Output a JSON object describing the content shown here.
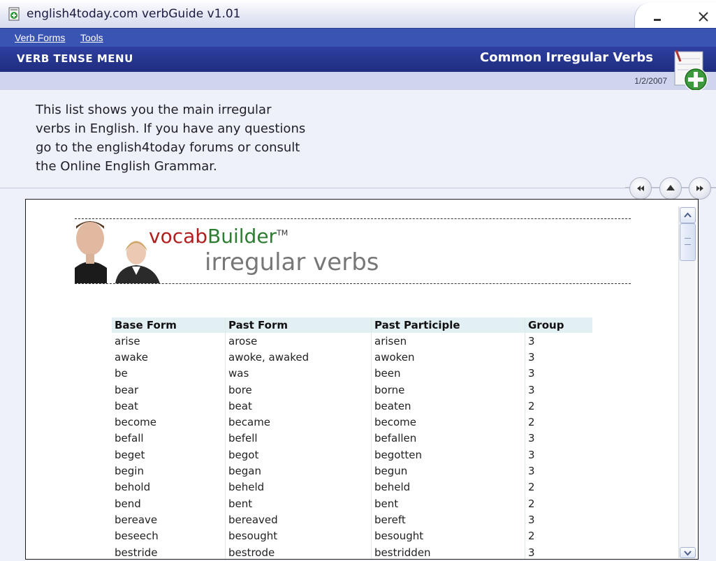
{
  "window": {
    "title": "english4today.com verbGuide v1.01",
    "minimize_icon": "minimize-icon",
    "close_icon": "close-icon"
  },
  "menubar": {
    "items": [
      {
        "label": "Verb Forms",
        "accel": "V"
      },
      {
        "label": "Tools",
        "accel": "T"
      }
    ]
  },
  "header": {
    "menu_title": "VERB TENSE MENU",
    "page_title": "Common Irregular Verbs",
    "date": "1/2/2007",
    "add_icon": "add-notebook-icon"
  },
  "intro": {
    "lines": [
      "This list shows you the main irregular",
      "verbs in English. If you have any questions",
      "go to the english4today forums or consult",
      "the Online English Grammar."
    ]
  },
  "nav": {
    "back_icon": "rewind-icon",
    "up_icon": "up-icon",
    "forward_icon": "fast-forward-icon"
  },
  "content": {
    "brand_part1": "vocab",
    "brand_part2": "Builder",
    "brand_tm": "TM",
    "subtitle": "irregular verbs",
    "table": {
      "headers": [
        "Base Form",
        "Past Form",
        "Past Participle",
        "Group"
      ],
      "rows": [
        [
          "arise",
          "arose",
          "arisen",
          "3"
        ],
        [
          "awake",
          "awoke, awaked",
          "awoken",
          "3"
        ],
        [
          "be",
          "was",
          "been",
          "3"
        ],
        [
          "bear",
          "bore",
          "borne",
          "3"
        ],
        [
          "beat",
          "beat",
          "beaten",
          "2"
        ],
        [
          "become",
          "became",
          "become",
          "2"
        ],
        [
          "befall",
          "befell",
          "befallen",
          "3"
        ],
        [
          "beget",
          "begot",
          "begotten",
          "3"
        ],
        [
          "begin",
          "began",
          "begun",
          "3"
        ],
        [
          "behold",
          "beheld",
          "beheld",
          "2"
        ],
        [
          "bend",
          "bent",
          "bent",
          "2"
        ],
        [
          "bereave",
          "bereaved",
          "bereft",
          "3"
        ],
        [
          "beseech",
          "besought",
          "besought",
          "2"
        ],
        [
          "bestride",
          "bestrode",
          "bestridden",
          "3"
        ]
      ]
    }
  },
  "colors": {
    "header_bg": "#1f2d7f",
    "menubar_bg": "#3a54b4",
    "brand_red": "#b02020",
    "brand_green": "#2e7d32",
    "table_header_bg": "#e3f0f3"
  }
}
